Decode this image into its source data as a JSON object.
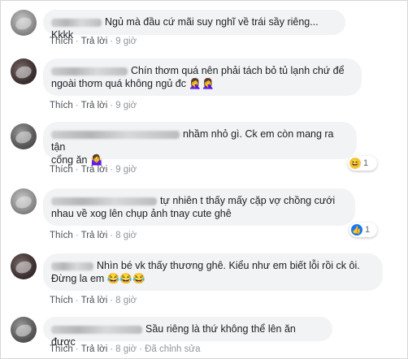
{
  "comments": [
    {
      "text": "Ngủ mà đầu cứ mãi suy nghĩ về trái sầy riêng... Kkkk",
      "actions": {
        "like": "Thích",
        "reply": "Trả lời",
        "time": "9 giờ"
      }
    },
    {
      "text_line1": "Chín thơm quá nên phải tách bỏ tủ lạnh chứ để",
      "text_line2": "ngoài thơm quá không ngủ đc 🤦‍♀️🤦‍♀️",
      "actions": {
        "like": "Thích",
        "reply": "Trả lời",
        "time": "9 giờ"
      }
    },
    {
      "text_line1": "nhầm nhỏ gì. Ck em còn mang ra tận",
      "text_line2": "cổng ăn 🤷‍♀️",
      "actions": {
        "like": "Thích",
        "reply": "Trả lời",
        "time": "9 giờ"
      },
      "reaction": {
        "icon": "haha-reaction-icon",
        "count": "1"
      }
    },
    {
      "text_line1": "tự nhiên t thấy mấy cặp vợ chồng cưới",
      "text_line2": "nhau về xog lên chụp ảnh tnay cute ghê",
      "actions": {
        "like": "Thích",
        "reply": "Trả lời",
        "time": "8 giờ"
      },
      "reaction": {
        "icon": "like-reaction-icon",
        "count": "1"
      }
    },
    {
      "text_line1": "Nhìn bé vk thấy thương ghê. Kiểu như em biết lỗi rồi ck ôi.",
      "text_line2": "Đừng la em 😂😂😂",
      "actions": {
        "like": "Thích",
        "reply": "Trả lời",
        "time": "8 giờ"
      }
    },
    {
      "text": "Sầu riêng là thứ không thể lên ăn được",
      "actions": {
        "like": "Thích",
        "reply": "Trả lời",
        "time": "8 giờ",
        "edited": "Đã chỉnh sửa"
      }
    }
  ],
  "colors": {
    "bubble": "#f2f3f5",
    "meta": "#90949c",
    "link": "#4b4f56",
    "like_blue": "#1877f2",
    "haha_yellow": "#f7c948"
  }
}
